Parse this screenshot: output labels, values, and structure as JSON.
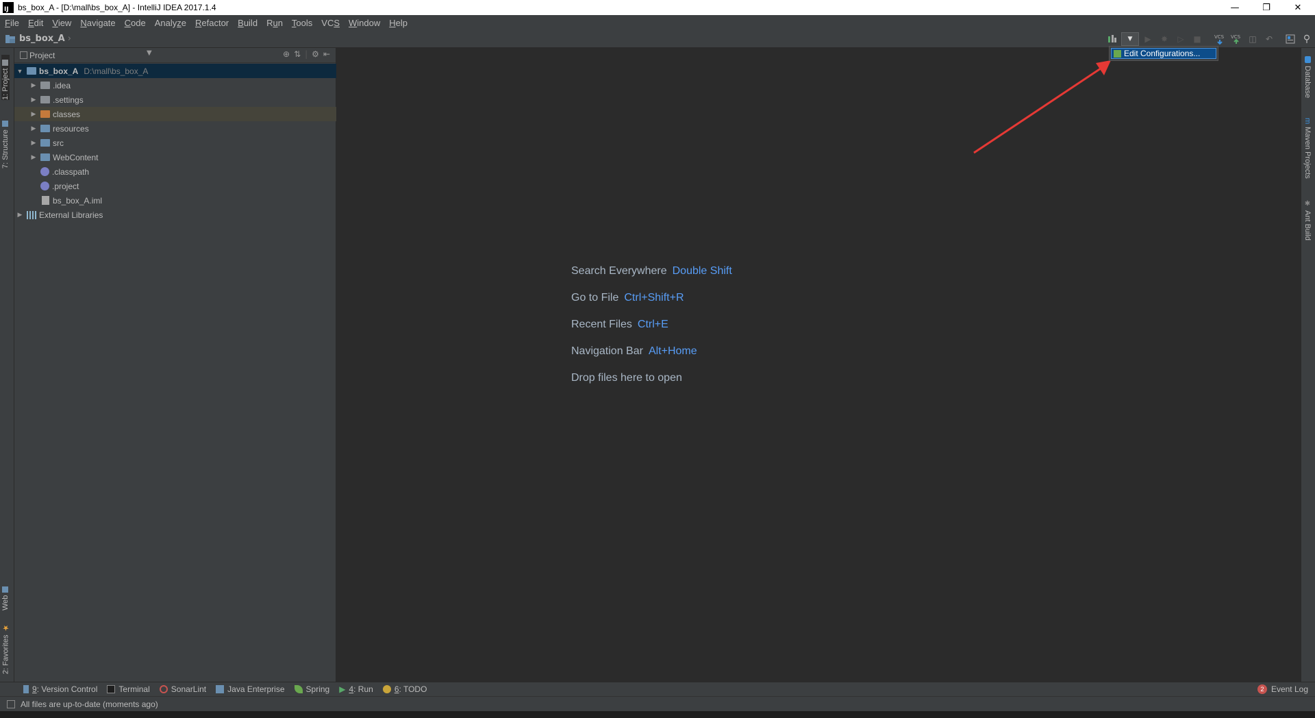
{
  "window": {
    "title": "bs_box_A - [D:\\mall\\bs_box_A] - IntelliJ IDEA 2017.1.4",
    "app_icon_text": "IJ"
  },
  "menu": [
    {
      "pre": "",
      "mn": "F",
      "post": "ile"
    },
    {
      "pre": "",
      "mn": "E",
      "post": "dit"
    },
    {
      "pre": "",
      "mn": "V",
      "post": "iew"
    },
    {
      "pre": "",
      "mn": "N",
      "post": "avigate"
    },
    {
      "pre": "",
      "mn": "C",
      "post": "ode"
    },
    {
      "pre": "Analy",
      "mn": "z",
      "post": "e"
    },
    {
      "pre": "",
      "mn": "R",
      "post": "efactor"
    },
    {
      "pre": "",
      "mn": "B",
      "post": "uild"
    },
    {
      "pre": "R",
      "mn": "u",
      "post": "n"
    },
    {
      "pre": "",
      "mn": "T",
      "post": "ools"
    },
    {
      "pre": "VC",
      "mn": "S",
      "post": ""
    },
    {
      "pre": "",
      "mn": "W",
      "post": "indow"
    },
    {
      "pre": "",
      "mn": "H",
      "post": "elp"
    }
  ],
  "navbar": {
    "crumb": "bs_box_A"
  },
  "left_tabs": {
    "project": "1: Project",
    "structure": "7: Structure",
    "web": "Web",
    "favorites": "2: Favorites"
  },
  "right_tabs": {
    "database": "Database",
    "maven": "Maven Projects",
    "ant": "Ant Build"
  },
  "project_panel": {
    "title": "Project",
    "root": {
      "name": "bs_box_A",
      "path": "D:\\mall\\bs_box_A"
    },
    "items": [
      {
        "name": ".idea"
      },
      {
        "name": ".settings"
      },
      {
        "name": "classes"
      },
      {
        "name": "resources"
      },
      {
        "name": "src"
      },
      {
        "name": "WebContent"
      },
      {
        "name": ".classpath"
      },
      {
        "name": ".project"
      },
      {
        "name": "bs_box_A.iml"
      }
    ],
    "external": "External Libraries"
  },
  "editor_hints": [
    {
      "label": "Search Everywhere",
      "key": "Double Shift"
    },
    {
      "label": "Go to File",
      "key": "Ctrl+Shift+R"
    },
    {
      "label": "Recent Files",
      "key": "Ctrl+E"
    },
    {
      "label": "Navigation Bar",
      "key": "Alt+Home"
    },
    {
      "label": "Drop files here to open",
      "key": ""
    }
  ],
  "popup": {
    "item": "Edit Configurations..."
  },
  "bottom_tools": [
    {
      "mn": "9",
      "label": ": Version Control"
    },
    {
      "mn": "",
      "label": "Terminal"
    },
    {
      "mn": "",
      "label": "SonarLint"
    },
    {
      "mn": "",
      "label": "Java Enterprise"
    },
    {
      "mn": "",
      "label": "Spring"
    },
    {
      "mn": "4",
      "label": ": Run"
    },
    {
      "mn": "6",
      "label": ": TODO"
    }
  ],
  "event_log": {
    "count": "2",
    "label": "Event Log"
  },
  "status": {
    "text": "All files are up-to-date (moments ago)"
  },
  "colors": {
    "accent": "#589df6",
    "selection": "#0d293e",
    "arrow": "#e53935"
  }
}
